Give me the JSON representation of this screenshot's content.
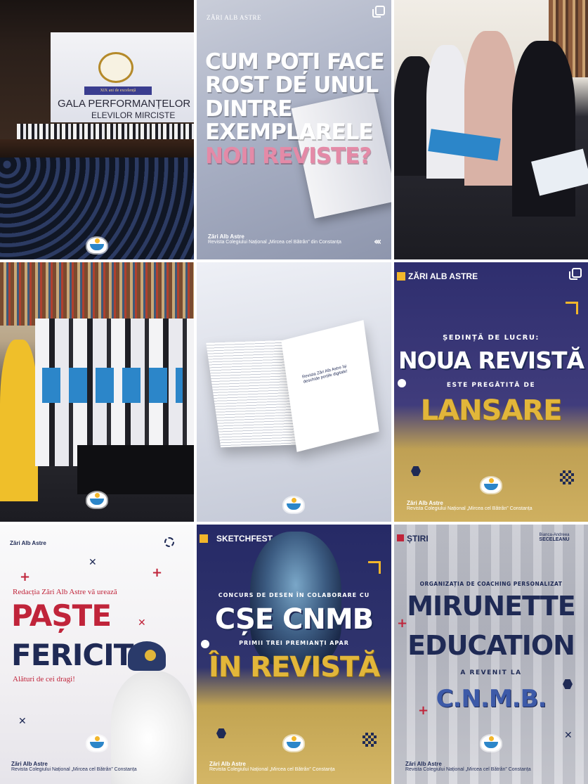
{
  "tiles": {
    "gala": {
      "stage_banner_line1": "GALA PERFORMANȚELOR",
      "stage_banner_line2": "ELEVILOR MIRCIȘTE",
      "ribbon": "XIX ani de excelență"
    },
    "promo": {
      "brand": "ZĂRI ALB ASTRE",
      "headline_lines": [
        "CUM POȚI FACE",
        "ROST DE UNUL",
        "DINTRE",
        "EXEMPLARELE"
      ],
      "headline_highlight": "NOII REVISTE?",
      "footer_name": "Zări Alb Astre",
      "footer_sub": "Revista Colegiului Național „Mircea cel Bătrân” din Constanța"
    },
    "magazine": {
      "spread_headline": "Revista Zări Alb Astre își deschide porțile digitale!"
    },
    "sedinta": {
      "brand": "ZĂRI ALB ASTRE",
      "kicker": "ȘEDINȚĂ DE LUCRU:",
      "headline": "NOUA REVISTĂ",
      "sub": "ESTE PREGĂTITĂ DE",
      "highlight": "LANSARE",
      "footer_name": "Zări Alb Astre",
      "footer_sub": "Revista Colegiului Național „Mircea cel Bătrân” Constanța"
    },
    "paste": {
      "brand": "Zări Alb Astre",
      "greeting": "Redacția Zări Alb Astre vă urează",
      "line1": "PAȘTE",
      "line2": "FERICIT",
      "tagline": "Alături de cei dragi!",
      "footer_name": "Zări Alb Astre",
      "footer_sub": "Revista Colegiului Național „Mircea cel Bătrân” Constanța"
    },
    "sketchfest": {
      "brand": "SKETCHFEST",
      "kicker": "CONCURS DE DESEN ÎN COLABORARE CU",
      "headline": "CȘE CNMB",
      "sub": "PRIMII TREI PREMIANȚI APAR",
      "highlight": "ÎN REVISTĂ",
      "footer_name": "Zări Alb Astre",
      "footer_sub": "Revista Colegiului Național „Mircea cel Bătrân” Constanța"
    },
    "stiri": {
      "brand": "ȘTIRI",
      "author_first": "Bianca-Andreea",
      "author_last": "SECELEANU",
      "kicker": "ORGANIZAȚIA DE COACHING PERSONALIZAT",
      "headline_line1": "MIRUNETTE",
      "headline_line2": "EDUCATION",
      "sub": "A REVENIT LA",
      "highlight": "C.N.M.B.",
      "footer_name": "Zări Alb Astre",
      "footer_sub": "Revista Colegiului Național „Mircea cel Bătrân” Constanța"
    }
  },
  "colors": {
    "navy": "#1f2a55",
    "gold": "#e2b63a",
    "pink": "#e48aa7",
    "red": "#c0243a",
    "brand_blue": "#2c86c9"
  },
  "icons": [
    "multiple-posts-icon",
    "magazine-logo-icon",
    "chevrons-icon",
    "cross-icon",
    "plus-icon",
    "hexagon-icon"
  ]
}
